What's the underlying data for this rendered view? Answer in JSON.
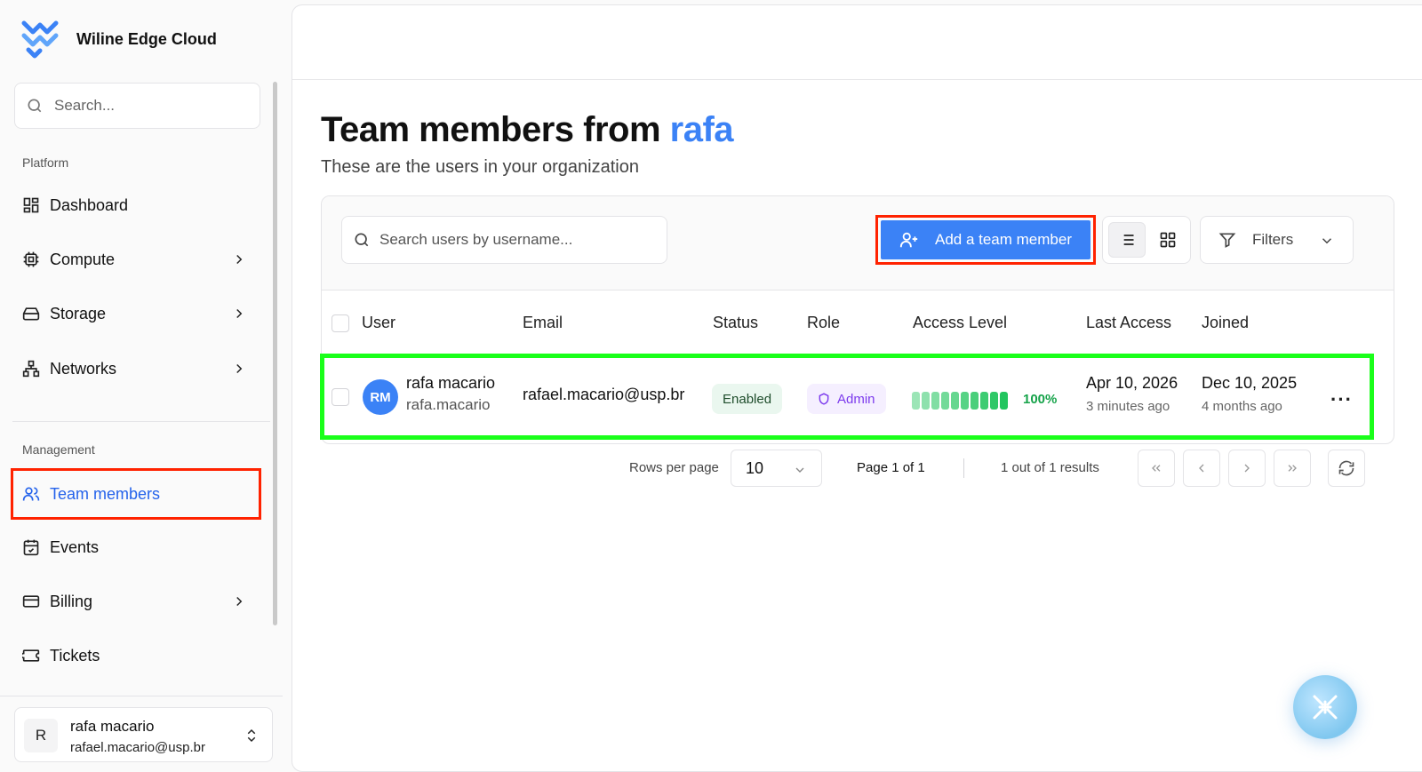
{
  "brand": {
    "name": "Wiline Edge Cloud",
    "logo_color": "#3b82f6"
  },
  "sidebar": {
    "search_placeholder": "Search...",
    "platform_label": "Platform",
    "platform_items": [
      {
        "label": "Dashboard",
        "icon": "dashboard-icon"
      },
      {
        "label": "Compute",
        "icon": "cpu-icon",
        "has_submenu": true
      },
      {
        "label": "Storage",
        "icon": "hard-drive-icon",
        "has_submenu": true
      },
      {
        "label": "Networks",
        "icon": "network-icon",
        "has_submenu": true
      }
    ],
    "management_label": "Management",
    "management_items": [
      {
        "label": "Team members",
        "icon": "users-icon",
        "active": true
      },
      {
        "label": "Events",
        "icon": "calendar-icon"
      },
      {
        "label": "Billing",
        "icon": "credit-card-icon",
        "has_submenu": true
      },
      {
        "label": "Tickets",
        "icon": "ticket-icon"
      }
    ],
    "user": {
      "initial": "R",
      "name": "rafa macario",
      "email": "rafael.macario@usp.br"
    }
  },
  "page": {
    "title_prefix": "Team members from",
    "org": "rafa",
    "subtitle": "These are the users in your organization"
  },
  "toolbar": {
    "search_placeholder": "Search users by username...",
    "add_button": "Add a team member",
    "filters_label": "Filters",
    "view_mode": "list"
  },
  "table": {
    "headers": {
      "user": "User",
      "email": "Email",
      "status": "Status",
      "role": "Role",
      "access": "Access Level",
      "last_access": "Last Access",
      "joined": "Joined"
    },
    "rows": [
      {
        "initials": "RM",
        "name": "rafa macario",
        "username": "rafa.macario",
        "email": "rafael.macario@usp.br",
        "status": "Enabled",
        "role": "Admin",
        "access_pct": "100%",
        "access_level": 1.0,
        "last_access_date": "Apr 10, 2026",
        "last_access_rel": "3 minutes ago",
        "joined_date": "Dec 10, 2025",
        "joined_rel": "4 months ago"
      }
    ]
  },
  "pagination": {
    "rows_per_page_label": "Rows per page",
    "rows_per_page": "10",
    "page_info": "Page 1 of 1",
    "results": "1 out of 1 results"
  },
  "colors": {
    "accent": "#3b82f6",
    "success": "#22c55e",
    "admin": "#7c3aed"
  }
}
